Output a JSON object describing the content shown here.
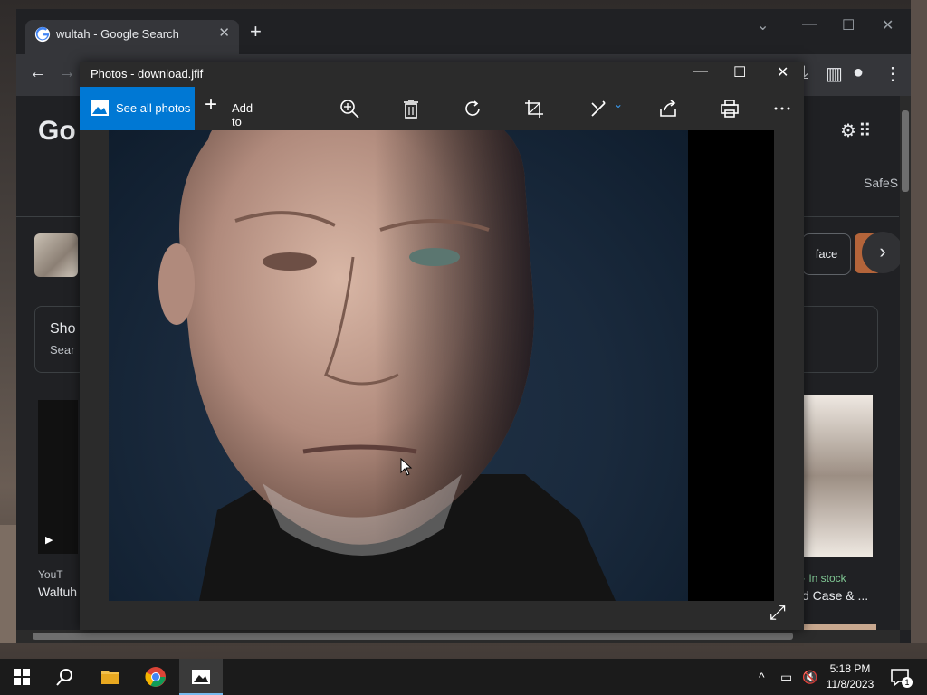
{
  "browser": {
    "tab_title": "wultah - Google Search",
    "new_tab_icon": "plus-icon"
  },
  "google": {
    "logo_partial": "Go",
    "safesearch_partial": "SafeS",
    "chip_face": "face",
    "show_title_partial": "Sho",
    "show_sub_partial": "Sear",
    "video_source": "YouT",
    "video_title_partial": "Waltuh",
    "product_stock": "· In stock",
    "product_title_partial": "d Case & ..."
  },
  "photos": {
    "window_title": "Photos - download.jfif",
    "see_all_label": "See all photos",
    "add_to_label": "Add to",
    "toolbar_icons": [
      "zoom-icon",
      "delete-icon",
      "rotate-icon",
      "crop-icon",
      "edit-icon",
      "share-icon",
      "print-icon",
      "more-icon"
    ]
  },
  "taskbar": {
    "time": "5:18 PM",
    "date": "11/8/2023",
    "notification_count": "1"
  }
}
